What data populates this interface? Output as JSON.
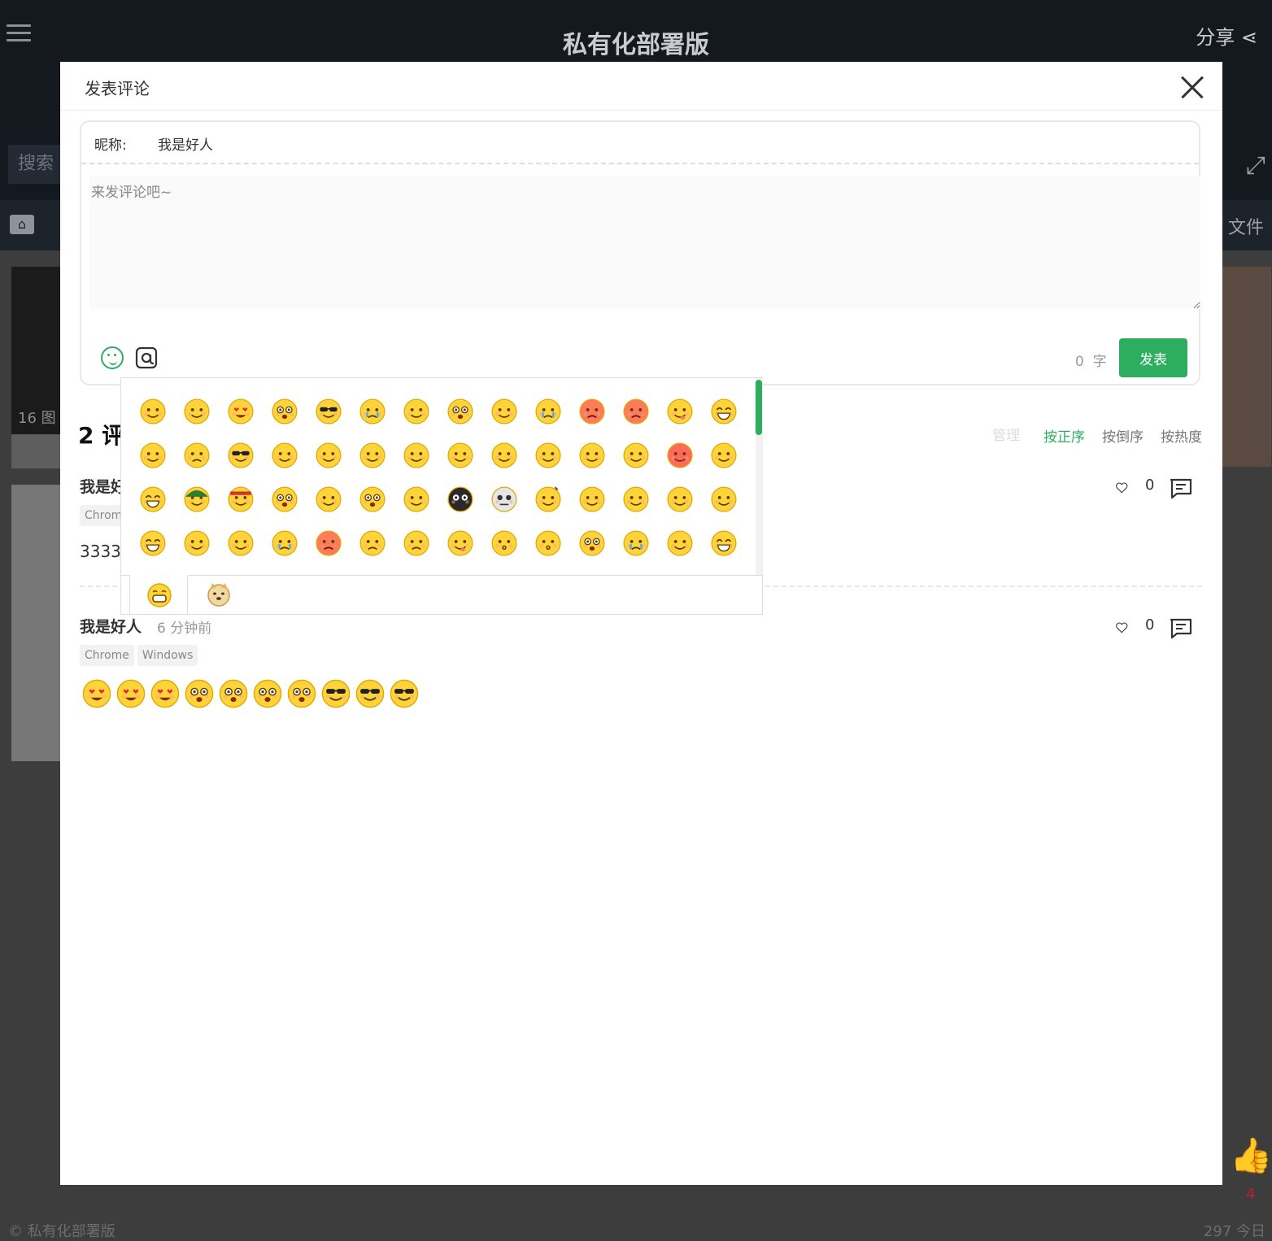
{
  "background": {
    "site_title": "私有化部署版",
    "share_label": "分享",
    "search_label": "搜索",
    "files_label": "文件",
    "thumb_label": "16 图",
    "like_count": "4",
    "footer_left": "© 私有化部署版",
    "footer_right": "297  今日"
  },
  "modal": {
    "title": "发表评论"
  },
  "editor": {
    "nickname_label": "昵称:",
    "nickname_value": "我是好人",
    "comment_placeholder": "来发评论吧~",
    "char_count": "0",
    "char_unit": "字",
    "submit_label": "发表"
  },
  "comments_header": {
    "count_text": "2 评",
    "manage_label": "管理",
    "sort_asc_label": "按正序",
    "sort_desc_label": "按倒序",
    "sort_hot_label": "按热度"
  },
  "comments": [
    {
      "author": "我是好",
      "time": "",
      "tags": [
        "Chrom"
      ],
      "text": "3333",
      "likes": "0"
    },
    {
      "author": "我是好人",
      "time": "6 分钟前",
      "tags": [
        "Chrome",
        "Windows"
      ],
      "emojis": [
        "heart-eyes",
        "heart-eyes",
        "heart-eyes",
        "shocked-drool",
        "shocked-drool",
        "shocked-drool",
        "shocked-drool",
        "cool",
        "cool",
        "cool"
      ],
      "likes": "0"
    }
  ],
  "emoji_panel": {
    "icons": [
      "smile",
      "bashful",
      "heart-eyes",
      "shocked-drool",
      "cool",
      "cry-loud",
      "annoyed",
      "cross-eyed",
      "sleepy",
      "sob",
      "angry-red",
      "furious",
      "tongue",
      "grin",
      "surprised",
      "sad",
      "sunglasses",
      "relieved",
      "vomit",
      "embarrassed",
      "snicker",
      "speechless",
      "curious",
      "awkward",
      "smile-2",
      "tired",
      "dizzy-red",
      "smirk",
      "laugh",
      "army-cap",
      "headband",
      "shocked",
      "shush",
      "dizzy",
      "frustrated",
      "bug",
      "skull",
      "poop",
      "think",
      "yawn",
      "sigh",
      "sweat",
      "giggle",
      "shy",
      "pout",
      "weep",
      "anger",
      "sulk",
      "sad-2",
      "wink-smirk",
      "kiss",
      "kiss-2",
      "scared",
      "cry",
      "plain-smile",
      "tears-of-joy"
    ],
    "tabs": [
      "classic-emoji-tab",
      "doge-emoji-tab"
    ],
    "scroll_color": "#2dae5f"
  },
  "colors": {
    "accent": "#2dae5f",
    "emoji_face": "#ffd43b",
    "emoji_outline": "#e0a800"
  }
}
